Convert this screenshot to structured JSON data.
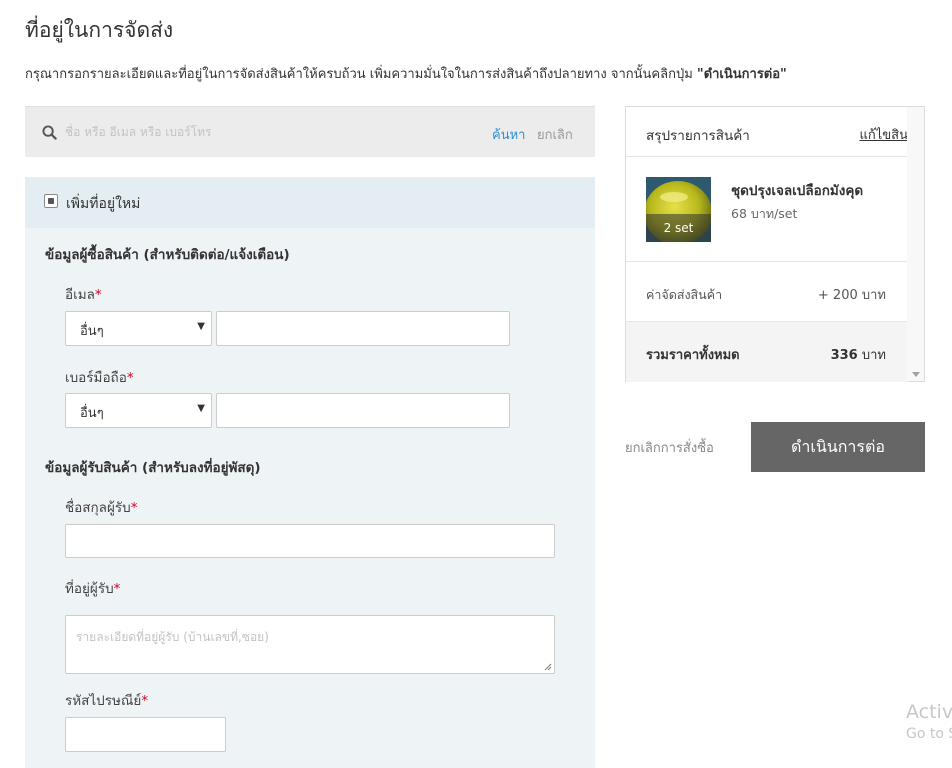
{
  "header": {
    "title": "ที่อยู่ในการจัดส่ง",
    "description_prefix": "กรุณากรอกรายละเอียดและที่อยู่ในการจัดส่งสินค้าให้ครบถ้วน เพิ่มความมั่นใจในการส่งสินค้าถึงปลายทาง จากนั้นคลิกปุ่ม ",
    "description_highlight": "\"ดำเนินการต่อ\""
  },
  "search": {
    "placeholder": "ชื่อ หรือ อีเมล หรือ เบอร์โทร",
    "search_label": "ค้นหา",
    "cancel_label": "ยกเลิก"
  },
  "form": {
    "add_new_label": "เพิ่มที่อยู่ใหม่",
    "buyer_section": "ข้อมูลผู้ซื้อสินค้า (สำหรับติดต่อ/แจ้งเตือน)",
    "email_label": "อีเมล",
    "email_select": "อื่นๆ",
    "email_value": "",
    "phone_label": "เบอร์มือถือ",
    "phone_select": "อื่นๆ",
    "phone_value": "",
    "receiver_section": "ข้อมูลผู้รับสินค้า (สำหรับลงที่อยู่พัสดุ)",
    "name_label": "ชื่อสกุลผู้รับ",
    "name_value": "",
    "address_label": "ที่อยู่ผู้รับ",
    "address_placeholder": "รายละเอียดที่อยู่ผู้รับ (บ้านเลขที่,ซอย)",
    "zip_label": "รหัสไปรษณีย์",
    "zip_value": "",
    "required_mark": "*"
  },
  "summary": {
    "title": "สรุปรายการสินค้า",
    "edit_label": "แก้ไขสินค้า",
    "items": [
      {
        "name": "ชุดปรุงเจลเปลือกมังคุด",
        "price": "68 บาท/set",
        "qty": "2 set"
      }
    ],
    "shipping_label": "ค่าจัดส่งสินค้า",
    "shipping_value": "+ 200 บาท",
    "total_label": "รวมราคาทั้งหมด",
    "total_amount": "336",
    "total_unit": " บาท"
  },
  "actions": {
    "cancel_order": "ยกเลิกการสั่งซื้อ",
    "continue": "ดำเนินการต่อ"
  },
  "system_overlay": {
    "line1": "Activ",
    "line2": "Go to S"
  },
  "colors": {
    "accent_link": "#2e8fcf",
    "required": "#d0021b",
    "button_bg": "#666666",
    "panel_bg": "#eef3f6"
  }
}
